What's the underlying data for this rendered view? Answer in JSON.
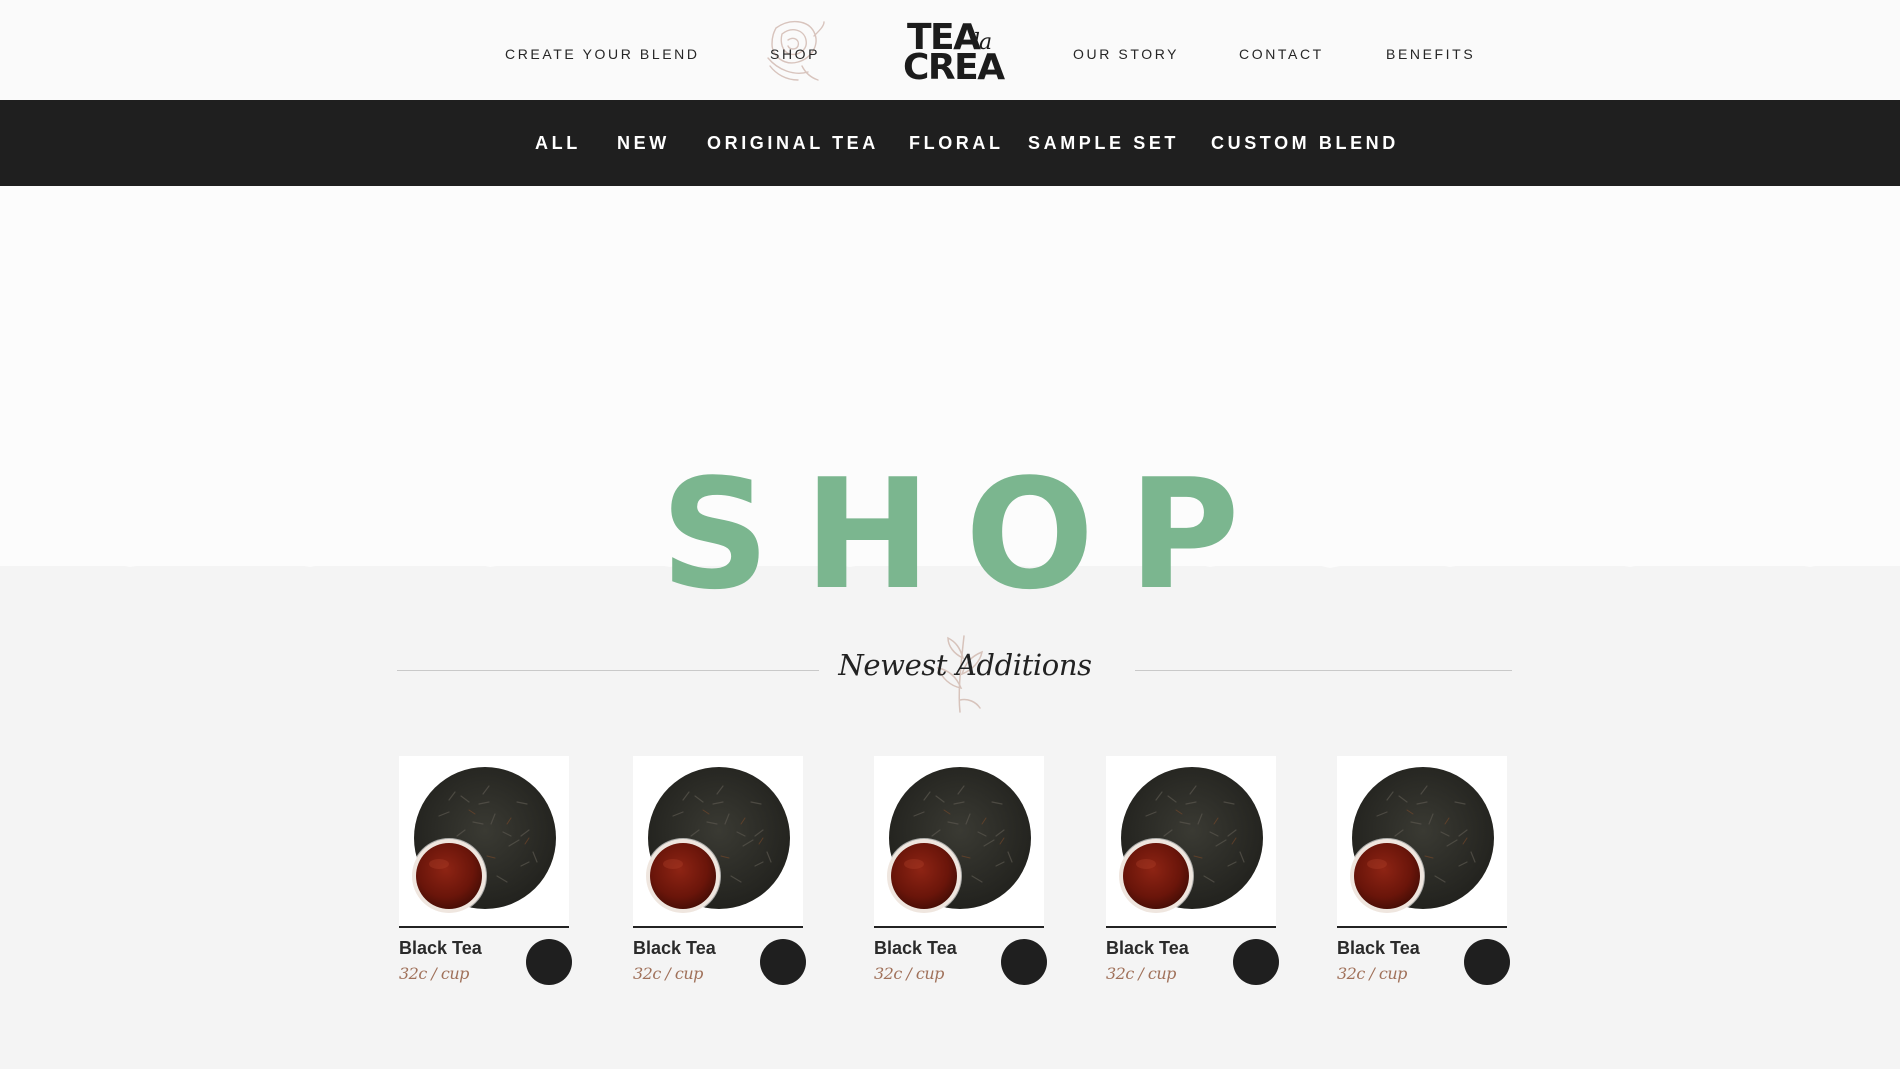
{
  "nav": {
    "create_blend": "CREATE YOUR BLEND",
    "shop": "SHOP",
    "our_story": "OUR STORY",
    "contact": "CONTACT",
    "benefits": "BENEFITS"
  },
  "logo": {
    "line1": "TEA",
    "la": "la",
    "line2": "CREA"
  },
  "categories": [
    "ALL",
    "NEW",
    "ORIGINAL TEA",
    "FLORAL",
    "SAMPLE SET",
    "CUSTOM BLEND"
  ],
  "hero": {
    "title": "SHOP"
  },
  "section": {
    "title": "Newest Additions"
  },
  "products": [
    {
      "name": "Black Tea",
      "price": "32c / cup"
    },
    {
      "name": "Black Tea",
      "price": "32c / cup"
    },
    {
      "name": "Black Tea",
      "price": "32c / cup"
    },
    {
      "name": "Black Tea",
      "price": "32c / cup"
    },
    {
      "name": "Black Tea",
      "price": "32c / cup"
    }
  ],
  "colors": {
    "accent_green": "#7bb68f",
    "dark_bar": "#1f1f1f",
    "price_brown": "#a0715a",
    "page_bg": "#f4f4f4"
  },
  "icons": {
    "nav_decoration": "rose-sketch-icon",
    "section_decoration": "sprig-sketch-icon",
    "add_to_cart": "add-circle-button"
  }
}
